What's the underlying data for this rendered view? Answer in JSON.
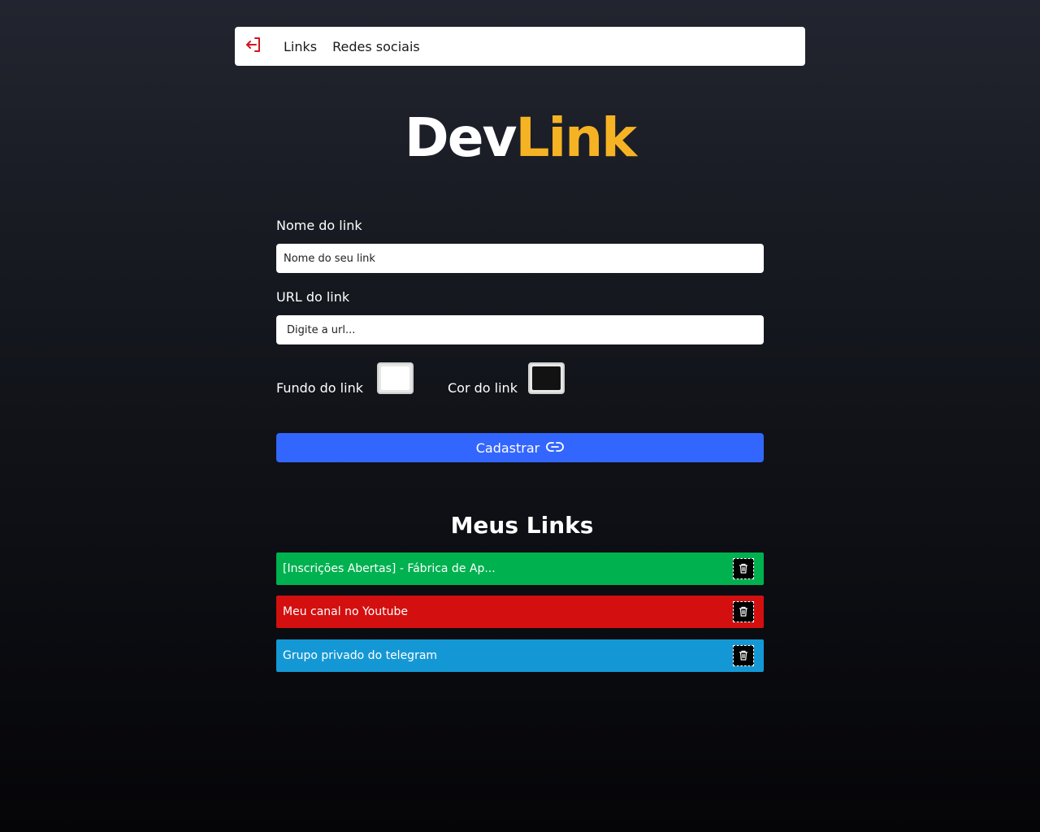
{
  "header": {
    "logout_icon": "logout-icon",
    "nav": [
      {
        "label": "Links"
      },
      {
        "label": "Redes sociais"
      }
    ]
  },
  "logo": {
    "part1": "Dev",
    "part2": "Link",
    "colors": {
      "part1": "#ffffff",
      "part2": "#f5b324"
    }
  },
  "form": {
    "name_label": "Nome do link",
    "name_placeholder": "Nome do seu link",
    "url_label": "URL do link",
    "url_placeholder": "Digite a url...",
    "bg_label": "Fundo do link",
    "bg_color": "#ffffff",
    "fg_label": "Cor do link",
    "fg_color": "#121212",
    "submit_label": "Cadastrar",
    "submit_icon": "link-icon",
    "submit_color": "#3366ff"
  },
  "my_links": {
    "title": "Meus Links",
    "items": [
      {
        "label": "[Inscrições Abertas] - Fábrica de Ap...",
        "bg": "#00b14f",
        "delete_icon": "trash-icon"
      },
      {
        "label": "Meu canal no Youtube",
        "bg": "#d40f0f",
        "delete_icon": "trash-icon"
      },
      {
        "label": "Grupo privado do telegram",
        "bg": "#1498d5",
        "delete_icon": "trash-icon"
      }
    ]
  }
}
